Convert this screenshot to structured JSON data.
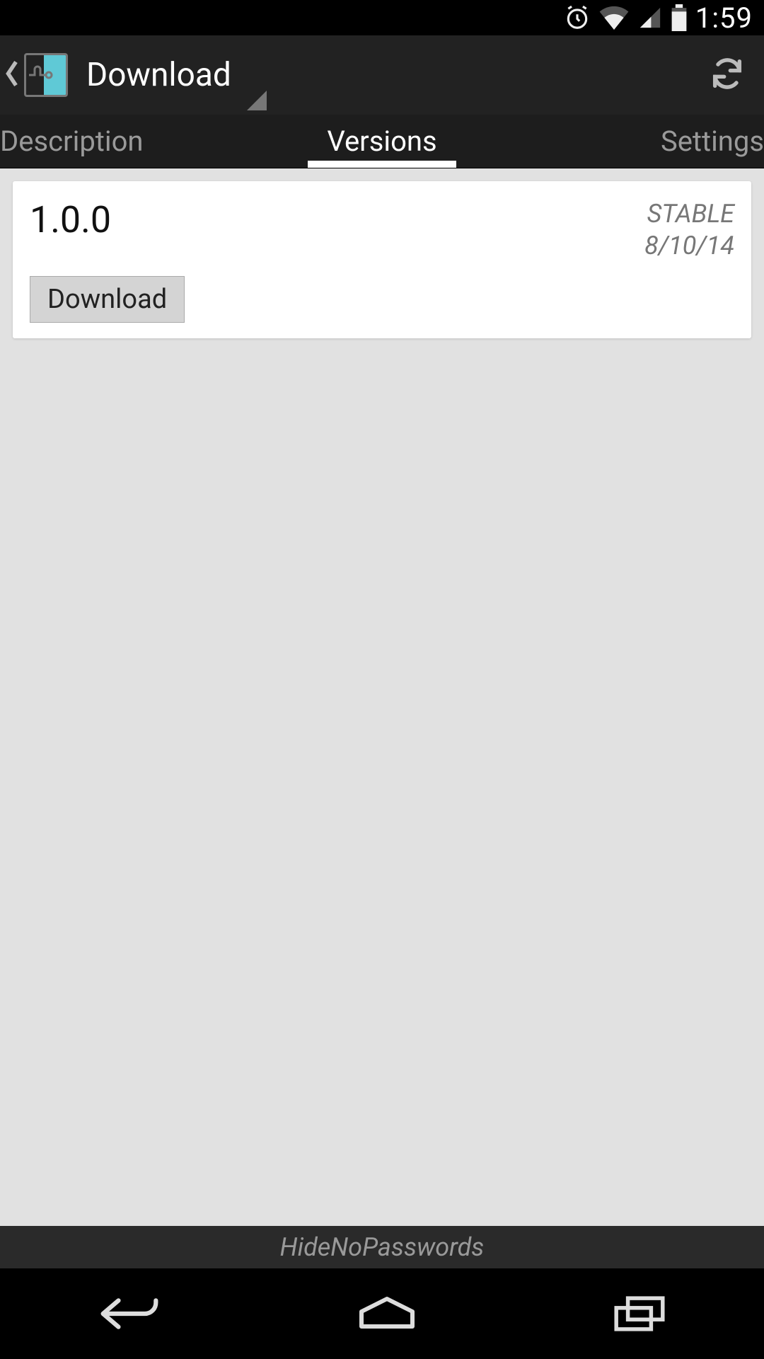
{
  "status": {
    "time": "1:59"
  },
  "action_bar": {
    "title": "Download"
  },
  "tabs": {
    "description": "Description",
    "versions": "Versions",
    "settings": "Settings",
    "active": "versions"
  },
  "version_card": {
    "version": "1.0.0",
    "channel": "STABLE",
    "date": "8/10/14",
    "download_label": "Download"
  },
  "footer": {
    "module_name": "HideNoPasswords"
  }
}
